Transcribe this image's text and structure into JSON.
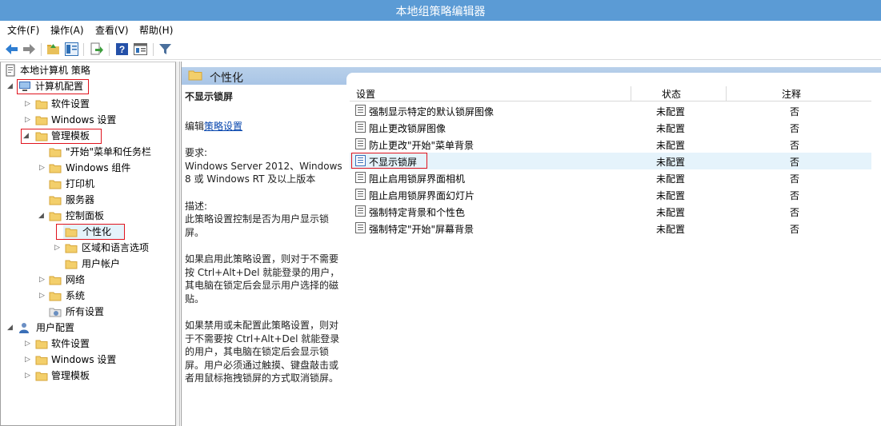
{
  "window": {
    "title": "本地组策略编辑器"
  },
  "menu": [
    {
      "label": "文件(F)"
    },
    {
      "label": "操作(A)"
    },
    {
      "label": "查看(V)"
    },
    {
      "label": "帮助(H)"
    }
  ],
  "toolbar": {
    "icons": [
      "back-icon",
      "forward-icon",
      "up-folder-icon",
      "show-hide-tree-icon",
      "export-list-icon",
      "help-icon",
      "properties-pane-icon",
      "filter-icon"
    ]
  },
  "tree": {
    "root": "本地计算机 策略",
    "computer_config": "计算机配置",
    "software_settings": "软件设置",
    "windows_settings": "Windows 设置",
    "admin_templates": "管理模板",
    "start_menu_taskbar": "\"开始\"菜单和任务栏",
    "windows_components": "Windows 组件",
    "printers": "打印机",
    "server": "服务器",
    "control_panel": "控制面板",
    "personalization": "个性化",
    "region_language": "区域和语言选项",
    "user_accounts": "用户帐户",
    "network": "网络",
    "system": "系统",
    "all_settings": "所有设置",
    "user_config": "用户配置",
    "user_software_settings": "软件设置",
    "user_windows_settings": "Windows 设置",
    "user_admin_templates": "管理模板"
  },
  "details": {
    "header": "个性化",
    "policy_title": "不显示锁屏",
    "edit_prefix": "编辑",
    "edit_link": "策略设置",
    "req_label": "要求:",
    "req_text": "Windows Server 2012、Windows 8 或 Windows RT 及以上版本",
    "desc_label": "描述:",
    "desc_text": "此策略设置控制是否为用户显示锁屏。",
    "enabled_text": "如果启用此策略设置，则对于不需要按 Ctrl+Alt+Del 就能登录的用户，其电脑在锁定后会显示用户选择的磁贴。",
    "disabled_text": "如果禁用或未配置此策略设置，则对于不需要按 Ctrl+Alt+Del 就能登录的用户，其电脑在锁定后会显示锁屏。用户必须通过触摸、键盘敲击或者用鼠标拖拽锁屏的方式取消锁屏。"
  },
  "list": {
    "headers": {
      "setting": "设置",
      "state": "状态",
      "comment": "注释"
    },
    "rows": [
      {
        "name": "强制显示特定的默认锁屏图像",
        "state": "未配置",
        "comment": "否"
      },
      {
        "name": "阻止更改锁屏图像",
        "state": "未配置",
        "comment": "否"
      },
      {
        "name": "防止更改\"开始\"菜单背景",
        "state": "未配置",
        "comment": "否"
      },
      {
        "name": "不显示锁屏",
        "state": "未配置",
        "comment": "否"
      },
      {
        "name": "阻止启用锁屏界面相机",
        "state": "未配置",
        "comment": "否"
      },
      {
        "name": "阻止启用锁屏界面幻灯片",
        "state": "未配置",
        "comment": "否"
      },
      {
        "name": "强制特定背景和个性色",
        "state": "未配置",
        "comment": "否"
      },
      {
        "name": "强制特定\"开始\"屏幕背景",
        "state": "未配置",
        "comment": "否"
      }
    ]
  },
  "colors": {
    "titlebar": "#5b9bd5",
    "highlight_box": "#e0141e",
    "selected_row": "#e5f3fb",
    "link": "#0645ad"
  }
}
